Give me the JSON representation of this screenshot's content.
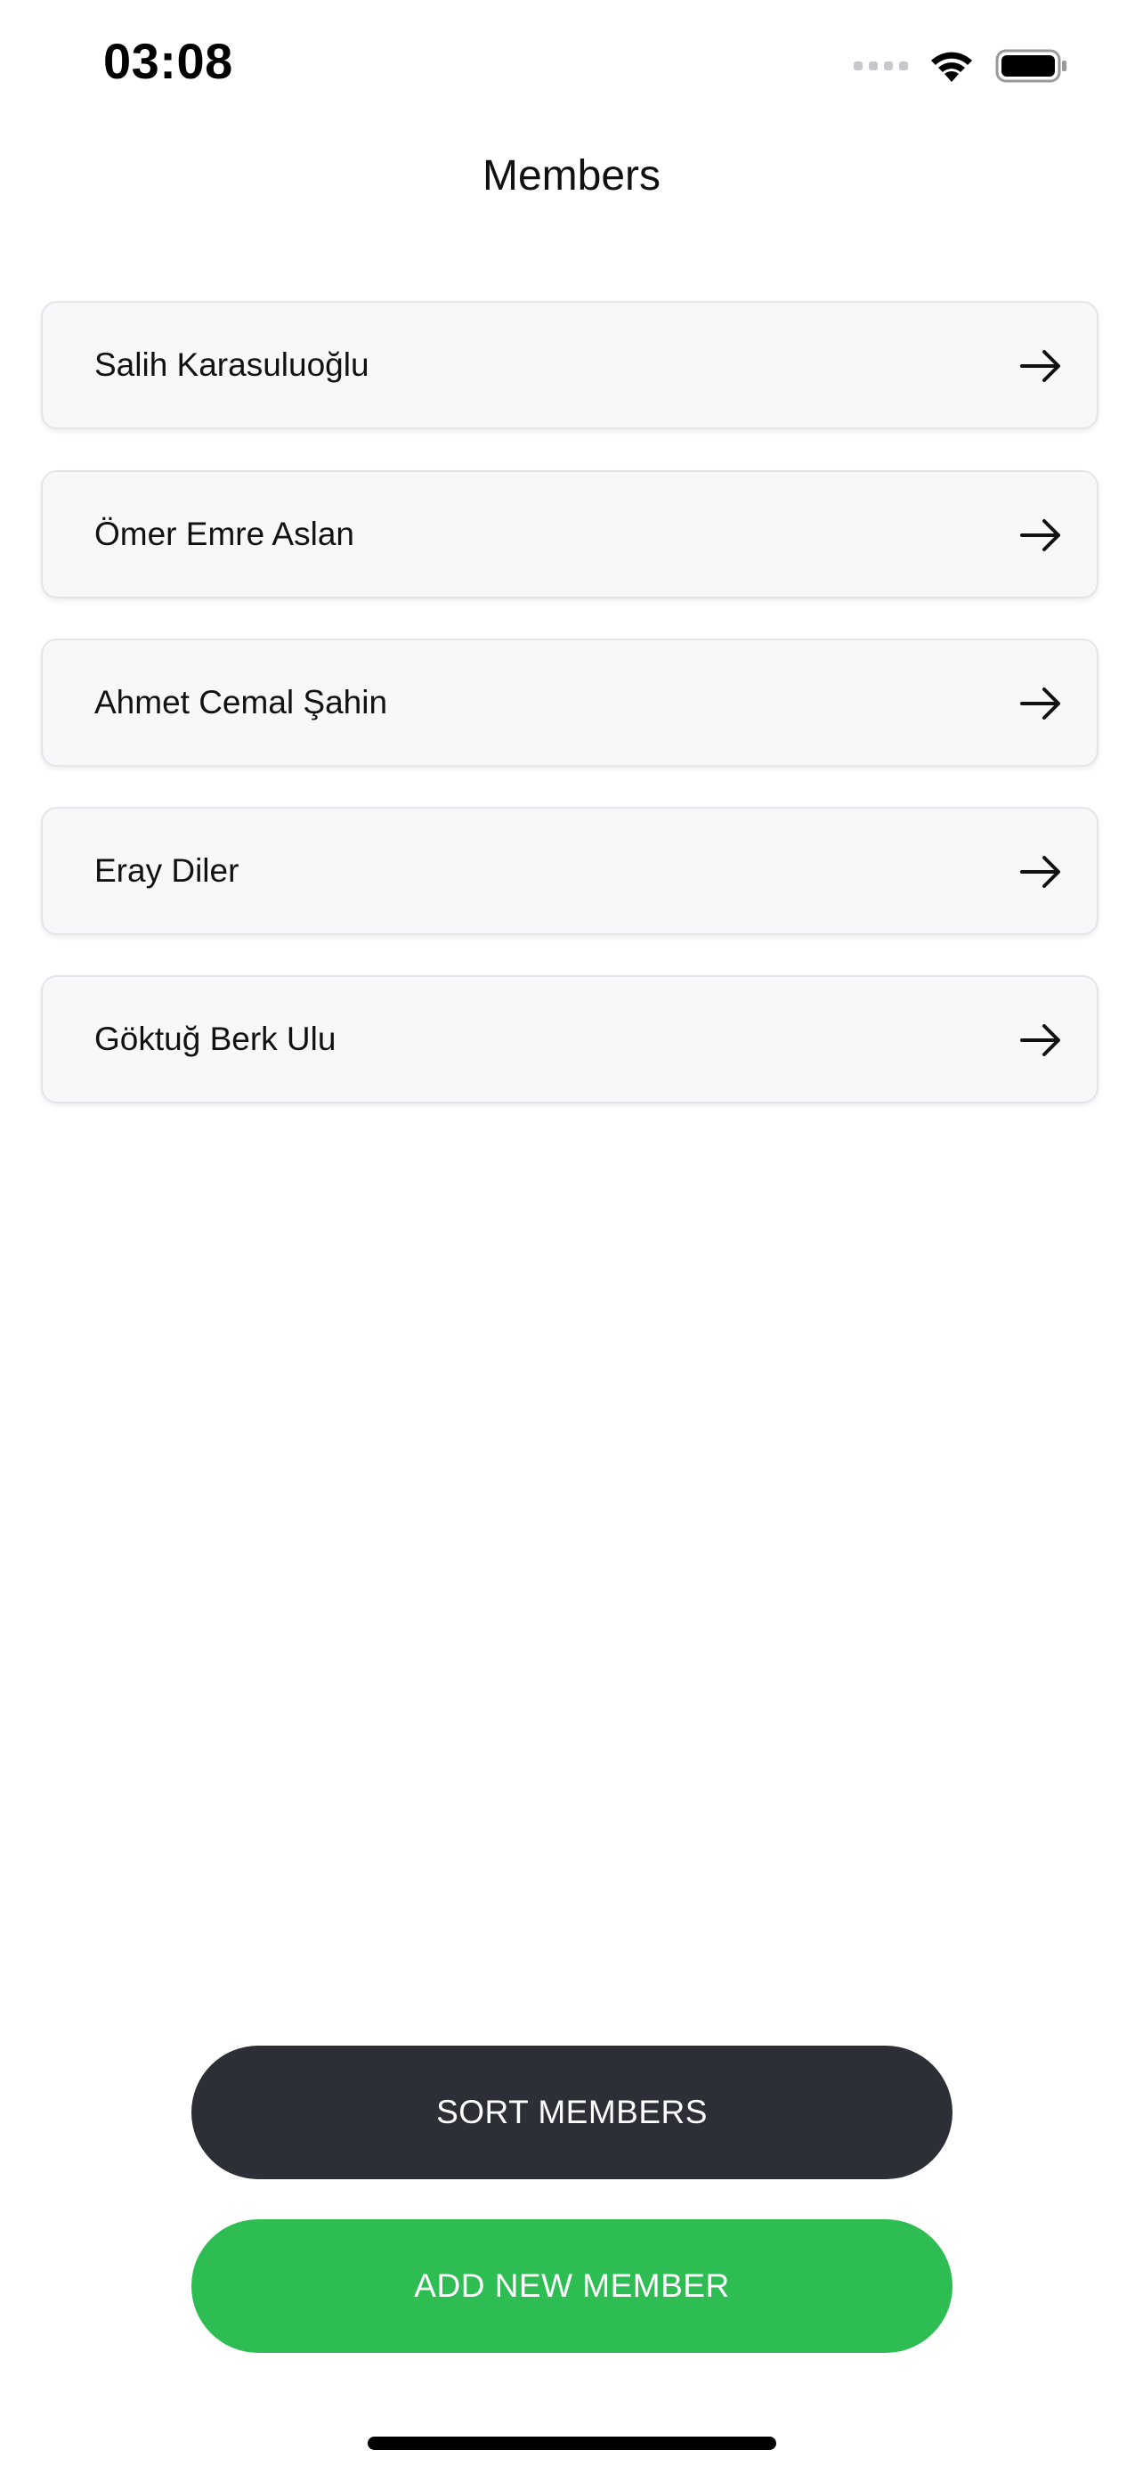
{
  "status_bar": {
    "time": "03:08",
    "icons": [
      "signal-dots-icon",
      "wifi-icon",
      "battery-icon"
    ]
  },
  "header": {
    "title": "Members"
  },
  "members": [
    {
      "name": "Salih Karasuluoğlu",
      "icon": "arrow-right-icon"
    },
    {
      "name": "Ömer Emre Aslan",
      "icon": "arrow-right-icon"
    },
    {
      "name": "Ahmet Cemal Şahin",
      "icon": "arrow-right-icon"
    },
    {
      "name": "Eray Diler",
      "icon": "arrow-right-icon"
    },
    {
      "name": "Göktuğ Berk Ulu",
      "icon": "arrow-right-icon"
    }
  ],
  "actions": {
    "sort_label": "SORT MEMBERS",
    "add_label": "ADD NEW MEMBER"
  },
  "colors": {
    "sort_button": "#2c3036",
    "add_button": "#2ebd53",
    "card_background": "#f7f8fa"
  }
}
